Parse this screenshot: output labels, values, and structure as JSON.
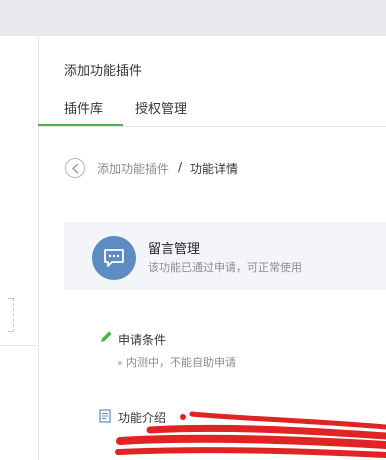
{
  "header": {
    "title": "添加功能插件"
  },
  "tabs": [
    {
      "label": "插件库"
    },
    {
      "label": "授权管理"
    }
  ],
  "breadcrumb": {
    "parent": "添加功能插件",
    "separator": "/",
    "current": "功能详情"
  },
  "plugin": {
    "name": "留言管理",
    "description": "该功能已通过申请，可正常使用",
    "icon": "chat-bubble-icon",
    "icon_color": "#5c8cc2"
  },
  "conditions": {
    "title": "申请条件",
    "items": [
      "内测中，不能自助申请"
    ],
    "icon": "pencil-icon",
    "icon_color": "#44b549"
  },
  "introduction": {
    "title": "功能介绍",
    "icon": "document-icon",
    "icon_color": "#5c8cc2"
  },
  "colors": {
    "accent": "#44b549",
    "annotation": "#e02424"
  }
}
